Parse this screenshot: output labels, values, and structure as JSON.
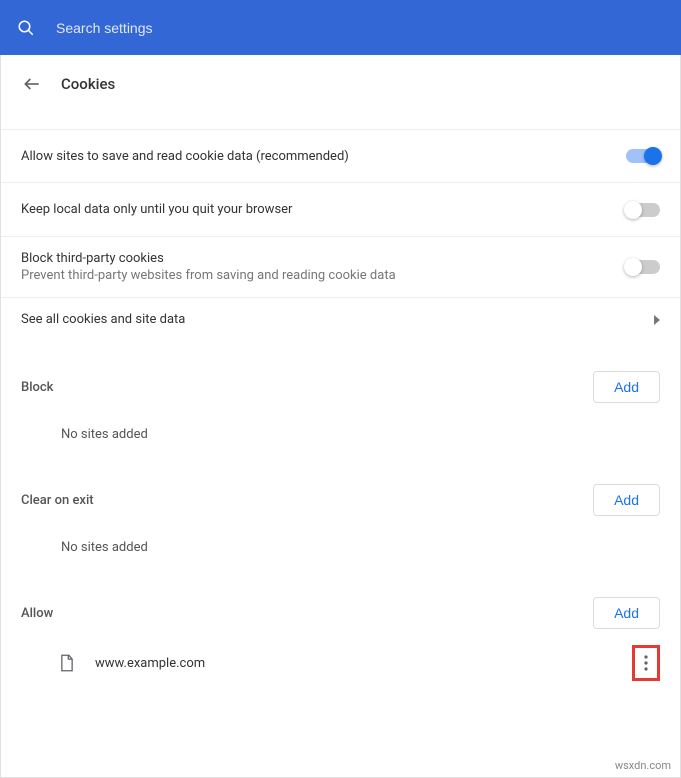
{
  "topbar": {
    "search_placeholder": "Search settings"
  },
  "header": {
    "title": "Cookies"
  },
  "settings": {
    "allow_sites": {
      "title": "Allow sites to save and read cookie data (recommended)",
      "on": true
    },
    "keep_local": {
      "title": "Keep local data only until you quit your browser",
      "on": false
    },
    "block_third": {
      "title": "Block third-party cookies",
      "sub": "Prevent third-party websites from saving and reading cookie data",
      "on": false
    },
    "see_all": {
      "title": "See all cookies and site data"
    }
  },
  "sections": {
    "block": {
      "title": "Block",
      "add_label": "Add",
      "empty": "No sites added"
    },
    "clear_on_exit": {
      "title": "Clear on exit",
      "add_label": "Add",
      "empty": "No sites added"
    },
    "allow": {
      "title": "Allow",
      "add_label": "Add",
      "items": [
        {
          "domain": "www.example.com"
        }
      ]
    }
  },
  "footer": {
    "watermark": "wsxdn.com"
  }
}
